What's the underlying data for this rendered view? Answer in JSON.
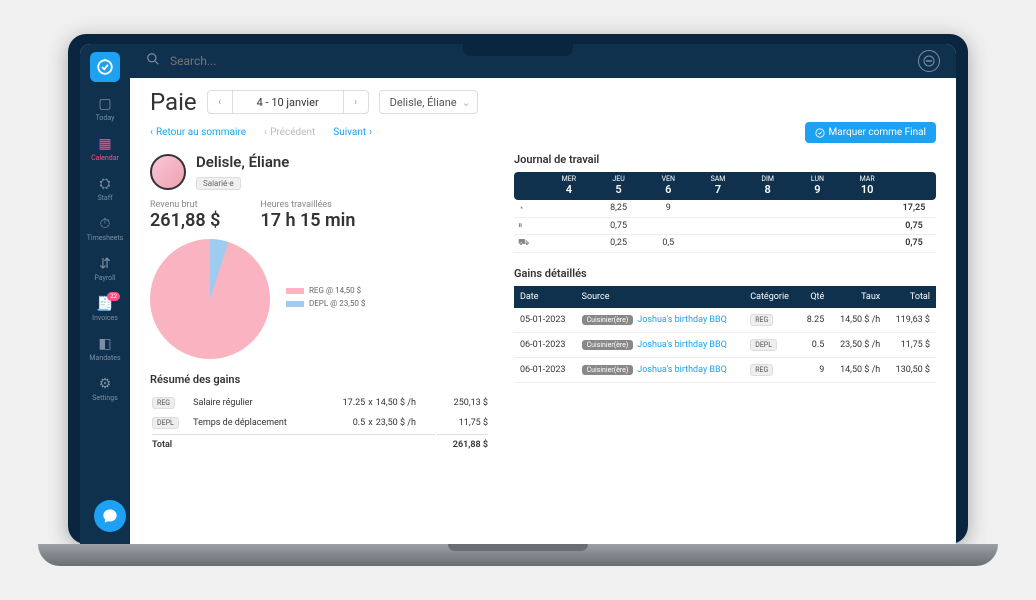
{
  "topbar": {
    "search_placeholder": "Search..."
  },
  "sidebar": {
    "items": [
      {
        "name": "today",
        "label": "Today",
        "icon": "▢"
      },
      {
        "name": "calendar",
        "label": "Calendar",
        "icon": "▦"
      },
      {
        "name": "staff",
        "label": "Staff",
        "icon": "⛭"
      },
      {
        "name": "timesheets",
        "label": "Timesheets",
        "icon": "⏱"
      },
      {
        "name": "payroll",
        "label": "Payroll",
        "icon": "⇵"
      },
      {
        "name": "invoices",
        "label": "Invoices",
        "icon": "🧾",
        "badge": "22"
      },
      {
        "name": "mandates",
        "label": "Mandates",
        "icon": "◧"
      },
      {
        "name": "settings",
        "label": "Settings",
        "icon": "⚙"
      }
    ]
  },
  "header": {
    "title": "Paie",
    "date_range": "4 - 10 janvier",
    "employee": "Delisle, Éliane"
  },
  "nav": {
    "back": "Retour au sommaire",
    "prev": "Précédent",
    "next": "Suivant",
    "mark_final": "Marquer comme Final"
  },
  "profile": {
    "name": "Delisle, Éliane",
    "role": "Salarié·e",
    "revenue_label": "Revenu brut",
    "revenue_value": "261,88 $",
    "hours_label": "Heures travaillées",
    "hours_value": "17 h 15 min"
  },
  "legend": {
    "reg": "REG @ 14,50 $",
    "depl": "DEPL @ 23,50 $"
  },
  "summary": {
    "title": "Résumé des gains",
    "rows": [
      {
        "tag": "REG",
        "label": "Salaire régulier",
        "qty": "17.25",
        "x": "x",
        "rate": "14,50 $ /h",
        "amount": "250,13 $"
      },
      {
        "tag": "DEPL",
        "label": "Temps de déplacement",
        "qty": "0.5",
        "x": "x",
        "rate": "23,50 $ /h",
        "amount": "11,75 $"
      }
    ],
    "total_label": "Total",
    "total_value": "261,88 $"
  },
  "worklog": {
    "title": "Journal de travail",
    "days": [
      {
        "label": "MER",
        "num": "4"
      },
      {
        "label": "JEU",
        "num": "5"
      },
      {
        "label": "VEN",
        "num": "6"
      },
      {
        "label": "SAM",
        "num": "7"
      },
      {
        "label": "DIM",
        "num": "8"
      },
      {
        "label": "LUN",
        "num": "9"
      },
      {
        "label": "MAR",
        "num": "10"
      }
    ],
    "rows": [
      {
        "icon": "◔",
        "cells": [
          "",
          "8,25",
          "9",
          "",
          "",
          "",
          ""
        ],
        "total": "17,25"
      },
      {
        "icon": "⏸",
        "cells": [
          "",
          "0,75",
          "",
          "",
          "",
          "",
          ""
        ],
        "total": "0,75"
      },
      {
        "icon": "⛟",
        "cells": [
          "",
          "0,25",
          "0,5",
          "",
          "",
          "",
          ""
        ],
        "total": "0,75"
      }
    ]
  },
  "detail": {
    "title": "Gains détaillés",
    "headers": {
      "date": "Date",
      "source": "Source",
      "cat": "Catégorie",
      "qty": "Qté",
      "rate": "Taux",
      "total": "Total"
    },
    "rows": [
      {
        "date": "05-01-2023",
        "source_tag": "Cuisinier(ère)",
        "event": "Joshua's birthday BBQ",
        "cat": "REG",
        "qty": "8.25",
        "rate": "14,50 $ /h",
        "total": "119,63 $"
      },
      {
        "date": "06-01-2023",
        "source_tag": "Cuisinier(ère)",
        "event": "Joshua's birthday BBQ",
        "cat": "DEPL",
        "qty": "0.5",
        "rate": "23,50 $ /h",
        "total": "11,75 $"
      },
      {
        "date": "06-01-2023",
        "source_tag": "Cuisinier(ère)",
        "event": "Joshua's birthday BBQ",
        "cat": "REG",
        "qty": "9",
        "rate": "14,50 $ /h",
        "total": "130,50 $"
      }
    ]
  },
  "colors": {
    "reg": "#fab3c1",
    "depl": "#9ecbef"
  }
}
